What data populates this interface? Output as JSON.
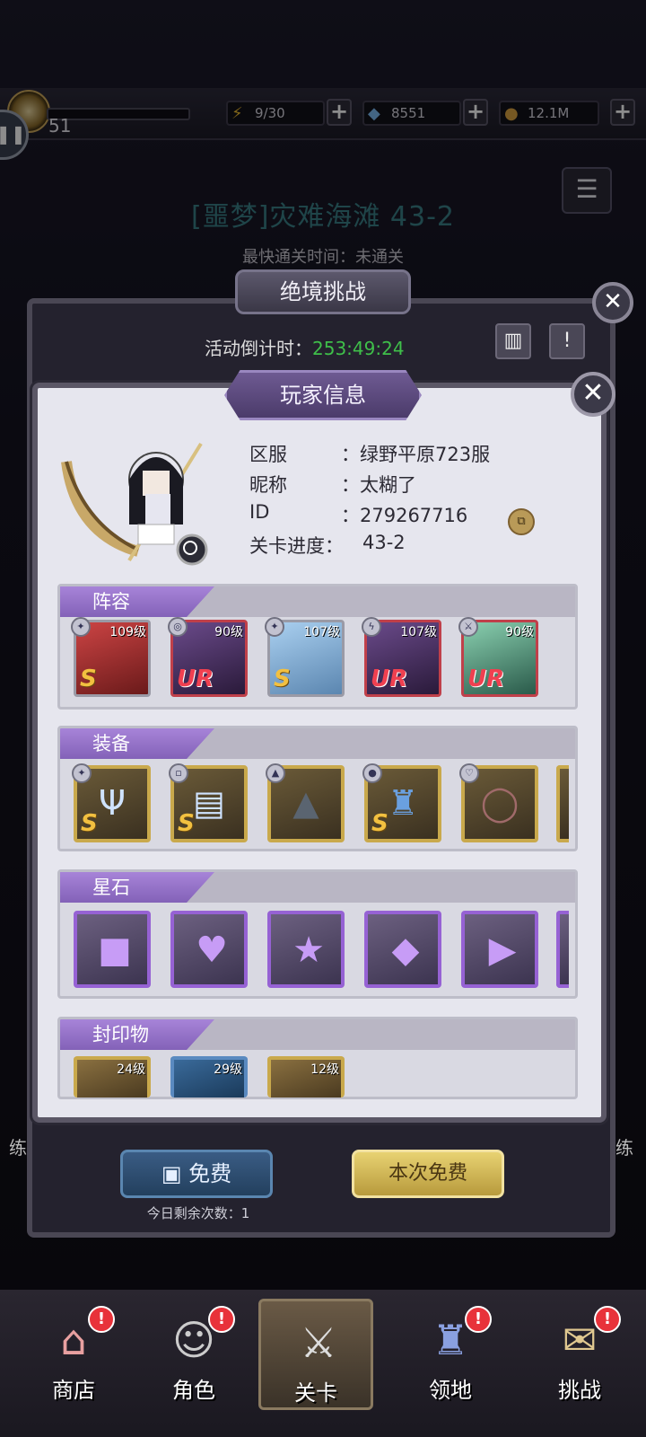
{
  "topbar": {
    "level": "51",
    "stamina": "9/30",
    "diamonds": "8551",
    "gold": "12.1M"
  },
  "stage": {
    "title": "[噩梦]灾难海滩 43-2",
    "fastest_label": "最快通关时间：",
    "fastest_value": "未通关"
  },
  "challenge": {
    "title": "绝境挑战",
    "countdown_label": "活动倒计时：",
    "countdown_value": "253:49:24",
    "free_label": "免费",
    "free_remaining": "今日剩余次数：1",
    "free_this_time": "本次免费"
  },
  "player_info": {
    "title": "玩家信息",
    "region_label": "区服",
    "region_value": "：绿野平原723服",
    "nickname_label": "昵称",
    "nickname_value": "：太糊了",
    "id_label": "ID",
    "id_value": "：279267716",
    "progress_label": "关卡进度：",
    "progress_value": "43-2",
    "copy_icon": "copy-icon"
  },
  "lineup": {
    "title": "阵容",
    "heroes": [
      {
        "level": "109级",
        "grade": "S"
      },
      {
        "level": "90级",
        "grade": "UR"
      },
      {
        "level": "107级",
        "grade": "S"
      },
      {
        "level": "107级",
        "grade": "UR"
      },
      {
        "level": "90级",
        "grade": "UR"
      }
    ]
  },
  "equipment": {
    "title": "装备",
    "items": [
      {
        "grade": "S",
        "icon": "trident-icon"
      },
      {
        "grade": "S",
        "icon": "book-icon"
      },
      {
        "grade": "",
        "icon": "witch-hat-icon"
      },
      {
        "grade": "S",
        "icon": "cloak-icon"
      },
      {
        "grade": "",
        "icon": "ring-icon"
      }
    ]
  },
  "starstones": {
    "title": "星石",
    "items": [
      "square-gem-icon",
      "heart-gem-icon",
      "star-gem-icon",
      "diamond-gem-icon",
      "triangle-gem-icon"
    ]
  },
  "seals": {
    "title": "封印物",
    "items": [
      {
        "level": "24级"
      },
      {
        "level": "29级"
      },
      {
        "level": "12级"
      }
    ]
  },
  "nav": {
    "shop": "商店",
    "character": "角色",
    "stage": "关卡",
    "territory": "领地",
    "challenge": "挑战",
    "badge": "!"
  },
  "side": {
    "left": "练",
    "right": "练"
  }
}
